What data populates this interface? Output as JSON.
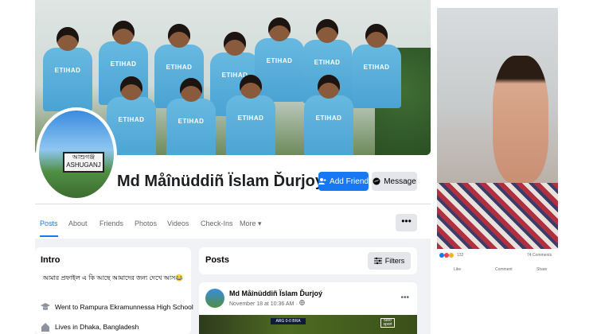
{
  "profile": {
    "name": "Md Måînüddiñ Ïslam Ďurjoý",
    "jersey_text": "ETIHAD",
    "avatar_sign": "আশুগঞ্জ ASHUGANJ"
  },
  "actions": {
    "add_friend": "Add Friend",
    "message": "Message",
    "more_dots": "•••"
  },
  "tabs": [
    "Posts",
    "About",
    "Friends",
    "Photos",
    "Videos",
    "Check-Ins",
    "More ▾"
  ],
  "intro": {
    "title": "Intro",
    "bio": "আমার প্রফাইল এ কি আছে আমাদের জন্য দেখে আস😂",
    "school": "Went to Rampura Ekramunnessa High School",
    "location": "Lives in Dhaka, Bangladesh"
  },
  "posts_section": {
    "title": "Posts",
    "filters_label": "Filters"
  },
  "post": {
    "author": "Md Måînüddiñ Ïslam Ďurjoý",
    "time": "November 18 at 10:36 AM · ",
    "score": "ARG 0-0 BRA",
    "tv_logo": "tubo sport"
  },
  "side_post": {
    "reaction_count": "132",
    "comments": "74 Comments",
    "like_label": "Like",
    "comment_label": "Comment",
    "share_label": "Share"
  },
  "colors": {
    "accent": "#1877f2",
    "background": "#f0f2f5",
    "text": "#050505",
    "muted": "#65676b"
  }
}
